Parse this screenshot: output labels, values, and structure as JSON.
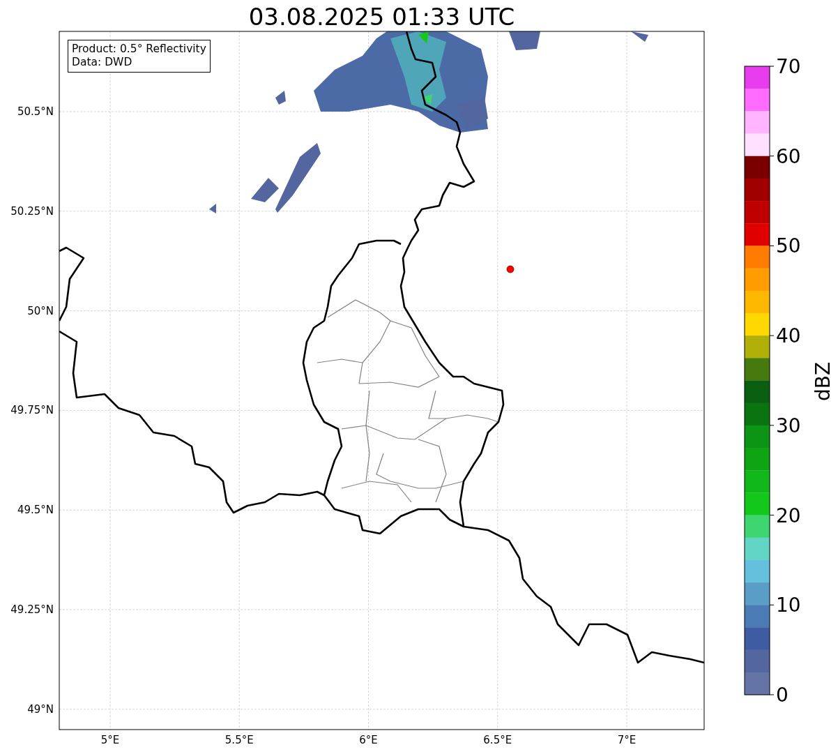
{
  "title": "03.08.2025 01:33 UTC",
  "info_box": {
    "lines": [
      "Product: 0.5° Reflectivity",
      "Data: DWD"
    ]
  },
  "map": {
    "y_ticks": [
      "50.5°N",
      "50.25°N",
      "50°N",
      "49.75°N",
      "49.5°N",
      "49.25°N",
      "49°N"
    ],
    "x_ticks": [
      "5°E",
      "5.5°E",
      "6°E",
      "6.5°E",
      "7°E"
    ]
  },
  "colorbar": {
    "label": "dBZ",
    "ticks": [
      "70",
      "60",
      "50",
      "40",
      "30",
      "20",
      "10",
      "0"
    ],
    "bins": [
      {
        "color": "#e83cef"
      },
      {
        "color": "#ff6cff"
      },
      {
        "color": "#ffb4ff"
      },
      {
        "color": "#ffe0ff"
      },
      {
        "color": "#7a0000"
      },
      {
        "color": "#a00000"
      },
      {
        "color": "#c00000"
      },
      {
        "color": "#e00000"
      },
      {
        "color": "#ff7c00"
      },
      {
        "color": "#ff9c00"
      },
      {
        "color": "#ffb800"
      },
      {
        "color": "#ffd800"
      },
      {
        "color": "#b0b008"
      },
      {
        "color": "#467a0e"
      },
      {
        "color": "#0a5e10"
      },
      {
        "color": "#0a7410"
      },
      {
        "color": "#0c9414"
      },
      {
        "color": "#0ea414"
      },
      {
        "color": "#10b81a"
      },
      {
        "color": "#12c81a"
      },
      {
        "color": "#3dd670"
      },
      {
        "color": "#62d6c6"
      },
      {
        "color": "#64c0dc"
      },
      {
        "color": "#5a9ec8"
      },
      {
        "color": "#4b7bb4"
      },
      {
        "color": "#3f5ca2"
      },
      {
        "color": "#5466a0"
      },
      {
        "color": "#6474a6"
      }
    ]
  }
}
